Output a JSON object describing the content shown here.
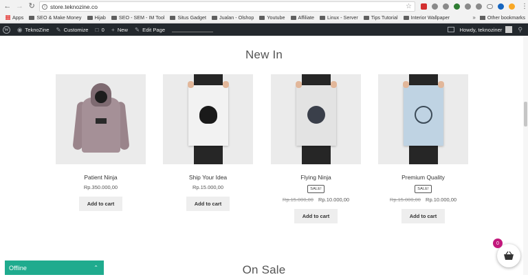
{
  "browser": {
    "url": "store.teknozine.co",
    "bookmarks": [
      {
        "label": "Apps",
        "type": "apps"
      },
      {
        "label": "SEO & Make Money",
        "type": "folder"
      },
      {
        "label": "Hijab",
        "type": "folder"
      },
      {
        "label": "SEO - SEM - IM Tool",
        "type": "folder"
      },
      {
        "label": "Situs Gadget",
        "type": "folder"
      },
      {
        "label": "Jualan - Olshop",
        "type": "folder"
      },
      {
        "label": "Youtube",
        "type": "folder"
      },
      {
        "label": "Affiliate",
        "type": "folder"
      },
      {
        "label": "Linux - Server",
        "type": "folder"
      },
      {
        "label": "Tips Tutorial",
        "type": "folder"
      },
      {
        "label": "Interior Wallpaper",
        "type": "folder"
      }
    ],
    "bookmarks_more": "»",
    "other_bookmarks": "Other bookmarks"
  },
  "adminbar": {
    "site_name": "TeknoZine",
    "customize": "Customize",
    "comments_count": "0",
    "new_label": "New",
    "edit_page": "Edit Page",
    "howdy": "Howdy, teknoziner"
  },
  "sections": {
    "new_in": "New In",
    "on_sale": "On Sale"
  },
  "products": [
    {
      "name": "Patient Ninja",
      "price": "Rp.350.000,00",
      "sale": false,
      "button": "Add to cart"
    },
    {
      "name": "Ship Your Idea",
      "price": "Rp.15.000,00",
      "sale": false,
      "button": "Add to cart"
    },
    {
      "name": "Flying Ninja",
      "sale": true,
      "badge": "SALE!",
      "old_price": "Rp.15.000,00",
      "price": "Rp.10.000,00",
      "button": "Add to cart"
    },
    {
      "name": "Premium Quality",
      "sale": true,
      "badge": "SALE!",
      "old_price": "Rp.15.000,00",
      "price": "Rp.10.000,00",
      "button": "Add to cart"
    }
  ],
  "chat": {
    "status": "Offline"
  },
  "cart": {
    "count": "0"
  },
  "colors": {
    "chat_bar": "#1fab8e",
    "cart_badge": "#c2187c",
    "admin_bar": "#23282d"
  }
}
